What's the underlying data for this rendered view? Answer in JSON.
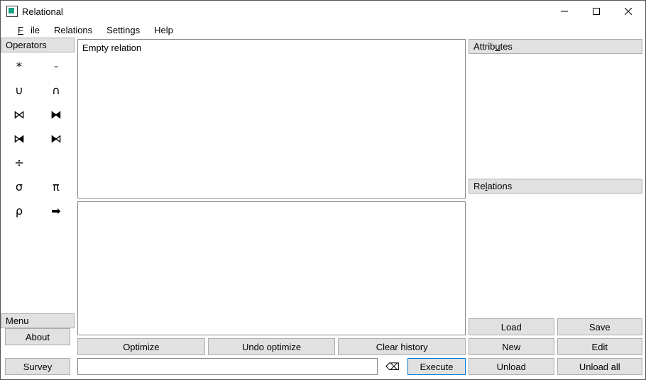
{
  "window": {
    "title": "Relational"
  },
  "menubar": {
    "file": "File",
    "file_u": "F",
    "relations": "Relations",
    "settings": "Settings",
    "help": "Help"
  },
  "sidebar": {
    "operators_header": "Operators",
    "ops": [
      "*",
      "-",
      "∪",
      "∩",
      "⋈",
      "⧓",
      "⧒",
      "⧑",
      "÷",
      "",
      "σ",
      "π",
      "ρ",
      "➡"
    ],
    "menu_header": "Menu",
    "about": "About",
    "survey": "Survey"
  },
  "center": {
    "result_text": "Empty relation",
    "optimize": "Optimize",
    "undo_optimize": "Undo optimize",
    "clear_history": "Clear history",
    "query_value": "",
    "execute": "Execute"
  },
  "right": {
    "attributes_header": "Attributes",
    "attributes_u": "u",
    "relations_header": "Relations",
    "relations_u": "l",
    "load": "Load",
    "save": "Save",
    "new": "New",
    "edit": "Edit",
    "unload": "Unload",
    "unload_all": "Unload all"
  }
}
